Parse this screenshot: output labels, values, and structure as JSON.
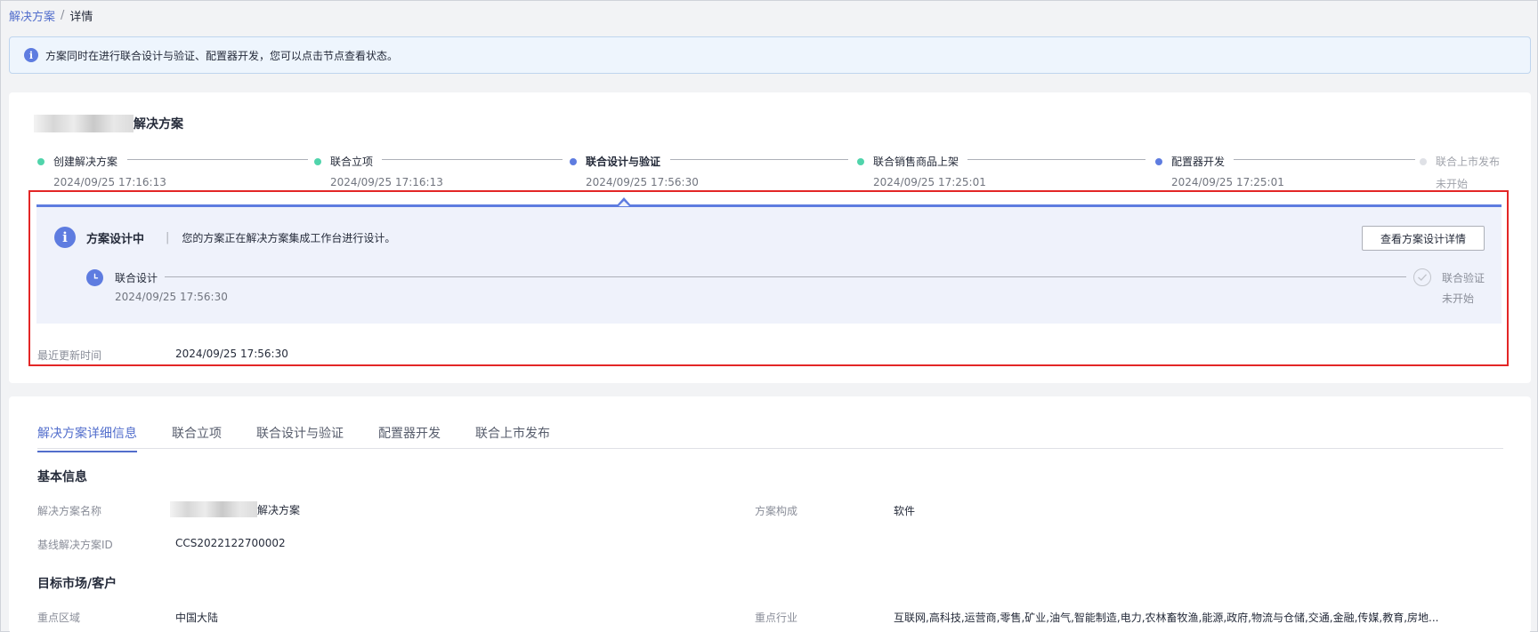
{
  "breadcrumb": {
    "parent": "解决方案",
    "separator": "/",
    "current": "详情"
  },
  "notice": {
    "text": "方案同时在进行联合设计与验证、配置器开发，您可以点击节点查看状态。",
    "icon": "info-icon"
  },
  "solution": {
    "title_suffix": "解决方案"
  },
  "timeline": [
    {
      "label": "创建解决方案",
      "time": "2024/09/25 17:16:13",
      "status": "done"
    },
    {
      "label": "联合立项",
      "time": "2024/09/25 17:16:13",
      "status": "done"
    },
    {
      "label": "联合设计与验证",
      "time": "2024/09/25 17:56:30",
      "status": "active"
    },
    {
      "label": "联合销售商品上架",
      "time": "2024/09/25 17:25:01",
      "status": "done"
    },
    {
      "label": "配置器开发",
      "time": "2024/09/25 17:25:01",
      "status": "active"
    },
    {
      "label": "联合上市发布",
      "time": "未开始",
      "status": "pending"
    }
  ],
  "stage": {
    "title": "方案设计中",
    "divider": "|",
    "desc": "您的方案正在解决方案集成工作台进行设计。",
    "button": "查看方案设计详情",
    "sub_start_label": "联合设计",
    "sub_start_time": "2024/09/25 17:56:30",
    "sub_end_label": "联合验证",
    "sub_end_time": "未开始",
    "update_label": "最近更新时间",
    "update_value": "2024/09/25 17:56:30"
  },
  "tabs": [
    "解决方案详细信息",
    "联合立项",
    "联合设计与验证",
    "配置器开发",
    "联合上市发布"
  ],
  "basic": {
    "section_title": "基本信息",
    "name_label": "解决方案名称",
    "name_suffix": "解决方案",
    "composition_label": "方案构成",
    "composition_value": "软件",
    "baseline_label": "基线解决方案ID",
    "baseline_value": "CCS2022122700002"
  },
  "market": {
    "section_title": "目标市场/客户",
    "region_label": "重点区域",
    "region_value": "中国大陆",
    "industry_label": "重点行业",
    "industry_value": "互联网,高科技,运营商,零售,矿业,油气,智能制造,电力,农林畜牧渔,能源,政府,物流与仓储,交通,金融,传媒,教育,房地..."
  },
  "colors": {
    "accent": "#5e7ce0",
    "success": "#50d4ab",
    "highlight_border": "#e32626",
    "link": "#526ecc"
  }
}
